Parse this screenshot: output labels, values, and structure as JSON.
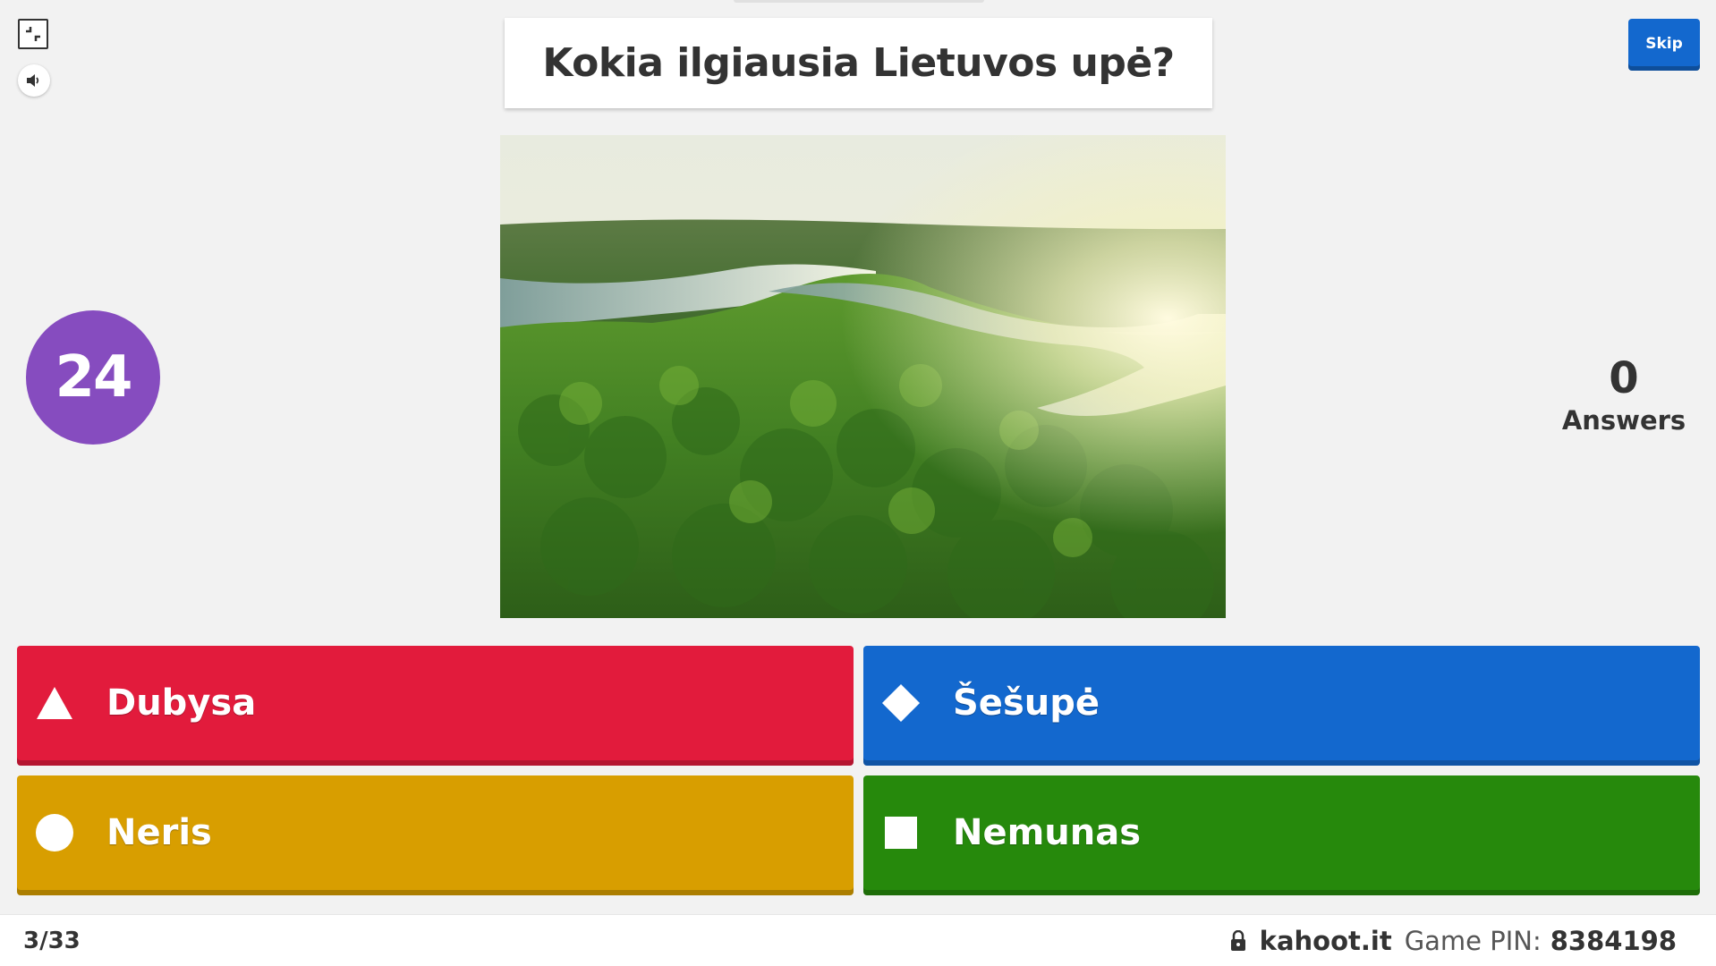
{
  "question": {
    "text": "Kokia ilgiausia Lietuvos upė?",
    "image_icon": "river-landscape-image"
  },
  "controls": {
    "fullscreen_icon": "exit-fullscreen-icon",
    "sound_icon": "speaker-icon",
    "skip_label": "Skip"
  },
  "timer": {
    "value": "24",
    "color": "#864cbf"
  },
  "answers_counter": {
    "count": "0",
    "label": "Answers"
  },
  "answers": [
    {
      "label": "Dubysa",
      "shape": "triangle-icon",
      "color": "#e21b3c"
    },
    {
      "label": "Šešupė",
      "shape": "diamond-icon",
      "color": "#1368ce"
    },
    {
      "label": "Neris",
      "shape": "circle-icon",
      "color": "#d89e00"
    },
    {
      "label": "Nemunas",
      "shape": "square-icon",
      "color": "#26890c"
    }
  ],
  "footer": {
    "progress": "3/33",
    "site": "kahoot.it",
    "pin_label": "Game PIN:",
    "pin_value": "8384198",
    "lock_icon": "lock-icon"
  }
}
